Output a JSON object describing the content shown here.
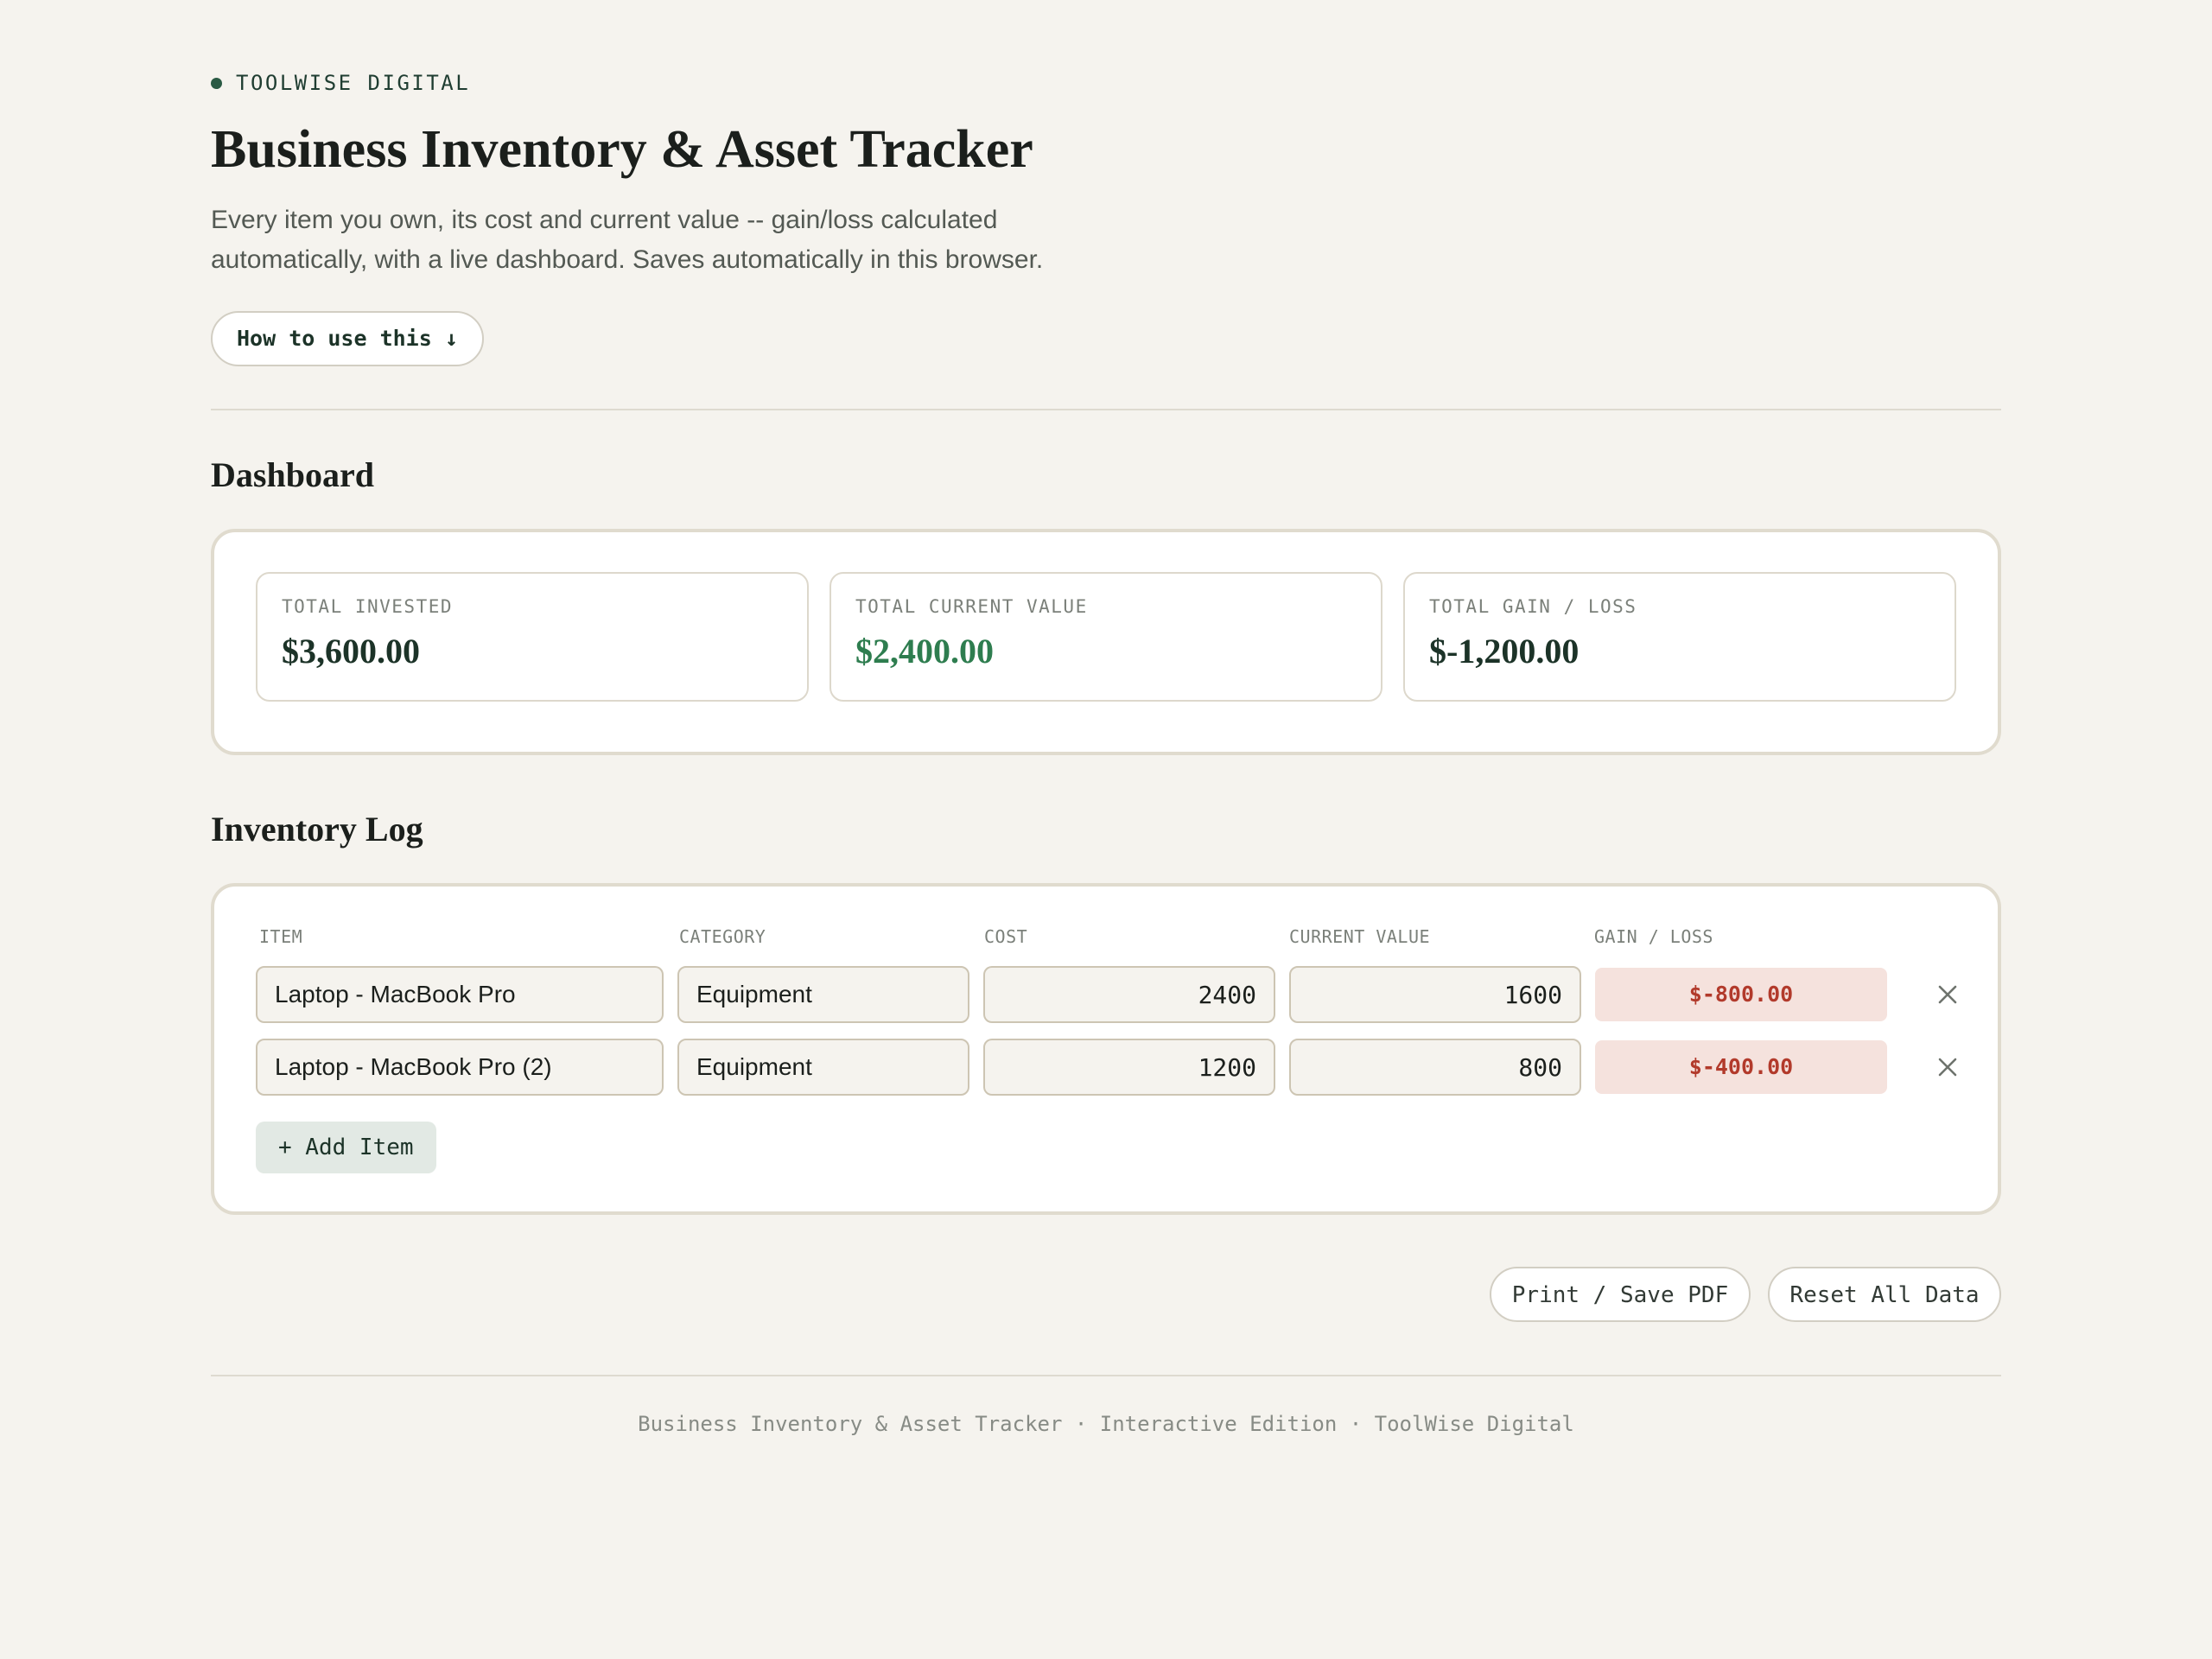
{
  "header": {
    "brand": "TOOLWISE DIGITAL",
    "title": "Business Inventory & Asset Tracker",
    "subtitle": "Every item you own, its cost and current value -- gain/loss calculated automatically, with a live dashboard. Saves automatically in this browser.",
    "howto_label": "How to use this ↓"
  },
  "dashboard": {
    "title": "Dashboard",
    "cards": [
      {
        "label": "TOTAL INVESTED",
        "value": "$3,600.00"
      },
      {
        "label": "TOTAL CURRENT VALUE",
        "value": "$2,400.00"
      },
      {
        "label": "TOTAL GAIN / LOSS",
        "value": "$-1,200.00"
      }
    ]
  },
  "inventory": {
    "title": "Inventory Log",
    "columns": [
      "ITEM",
      "CATEGORY",
      "COST",
      "CURRENT VALUE",
      "GAIN / LOSS"
    ],
    "rows": [
      {
        "item": "Laptop - MacBook Pro",
        "category": "Equipment",
        "cost": "2400",
        "current_value": "1600",
        "gain_loss": "$-800.00"
      },
      {
        "item": "Laptop - MacBook Pro (2)",
        "category": "Equipment",
        "cost": "1200",
        "current_value": "800",
        "gain_loss": "$-400.00"
      }
    ],
    "add_label": "+ Add Item"
  },
  "actions": {
    "print_label": "Print / Save PDF",
    "reset_label": "Reset All Data"
  },
  "footer": {
    "text": "Business Inventory & Asset Tracker · Interactive Edition · ToolWise Digital"
  },
  "colors": {
    "background": "#f5f3ee",
    "accent": "#2a5a44",
    "positive": "#2e7d4f",
    "negative": "#b23a2b",
    "negative_bg": "#f5e2dd"
  },
  "icons": {
    "brand": "dot-icon",
    "delete": "close-icon"
  }
}
